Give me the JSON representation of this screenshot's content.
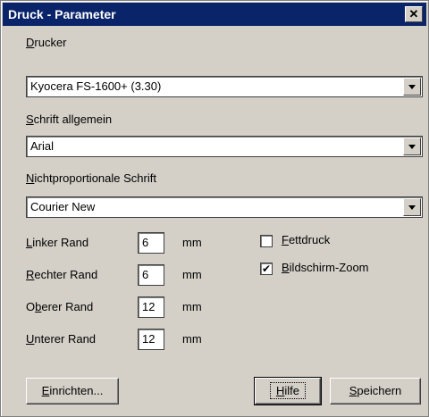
{
  "window": {
    "title": "Druck - Parameter",
    "close_symbol": "✕"
  },
  "printer": {
    "label_mnemonic": "D",
    "label_rest": "rucker",
    "value": "Kyocera FS-1600+ (3.30)"
  },
  "font_general": {
    "label_mnemonic": "S",
    "label_rest": "chrift allgemein",
    "value": "Arial"
  },
  "font_mono": {
    "label_mnemonic": "N",
    "label_rest": "ichtproportionale Schrift",
    "value": "Courier New"
  },
  "margins": {
    "left": {
      "label_mnemonic": "L",
      "label_rest": "inker Rand",
      "value": "6",
      "unit": "mm"
    },
    "right": {
      "label_mnemonic": "R",
      "label_rest": "echter Rand",
      "value": "6",
      "unit": "mm"
    },
    "top": {
      "label_pre": "O",
      "label_mnemonic": "b",
      "label_rest": "erer Rand",
      "value": "12",
      "unit": "mm"
    },
    "bottom": {
      "label_mnemonic": "U",
      "label_rest": "nterer Rand",
      "value": "12",
      "unit": "mm"
    }
  },
  "options": {
    "bold": {
      "label_mnemonic": "F",
      "label_rest": "ettdruck",
      "checked": false,
      "mark": ""
    },
    "zoom": {
      "label_mnemonic": "B",
      "label_rest": "ildschirm-Zoom",
      "checked": true,
      "mark": "✔"
    }
  },
  "buttons": {
    "setup": {
      "label_mnemonic": "E",
      "label_rest": "inrichten..."
    },
    "help": {
      "label_mnemonic": "H",
      "label_rest": "ilfe"
    },
    "save": {
      "label_mnemonic": "S",
      "label_rest": "peichern"
    }
  }
}
